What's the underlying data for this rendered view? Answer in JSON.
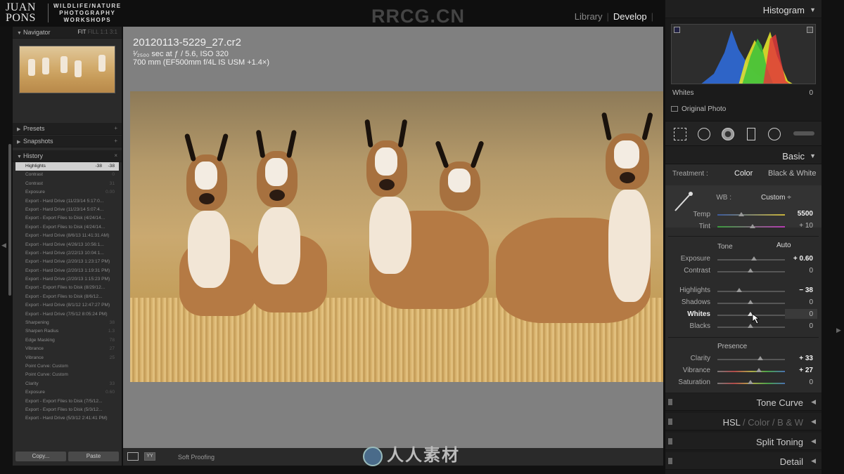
{
  "branding": {
    "logo_name": "JUAN PONS",
    "logo_line1": "WILDLIFE/NATURE",
    "logo_line2": "PHOTOGRAPHY",
    "logo_line3": "WORKSHOPS",
    "watermark": "RRCG.CN",
    "bottom_watermark": "人人素材"
  },
  "modules": {
    "library": "Library",
    "develop": "Develop",
    "sep": "|"
  },
  "left": {
    "navigator": {
      "title": "Navigator",
      "zoom_fit": "FIT",
      "zoom_fill": "FILL",
      "zoom_1": "1:1",
      "zoom_custom": "3:1"
    },
    "presets": {
      "title": "Presets",
      "icon": "+"
    },
    "snapshots": {
      "title": "Snapshots",
      "icon": "+"
    },
    "history": {
      "title": "History",
      "icon": "×",
      "items": [
        {
          "label": "Highlights",
          "v1": "-38",
          "v2": "-38",
          "selected": true
        },
        {
          "label": "Contrast",
          "v1": "",
          "v2": "0"
        },
        {
          "label": "Contrast",
          "v1": "",
          "v2": "31"
        },
        {
          "label": "Exposure",
          "v1": "",
          "v2": "0.00"
        },
        {
          "label": "Export - Hard Drive (11/23/14 5:17:0...",
          "v1": "",
          "v2": ""
        },
        {
          "label": "Export - Hard Drive (11/23/14 5:07:4...",
          "v1": "",
          "v2": ""
        },
        {
          "label": "Export - Export Files to Disk (4/24/14...",
          "v1": "",
          "v2": ""
        },
        {
          "label": "Export - Export Files to Disk (4/24/14...",
          "v1": "",
          "v2": ""
        },
        {
          "label": "Export - Hard Drive (8/6/13 11:41:31 AM)",
          "v1": "",
          "v2": ""
        },
        {
          "label": "Export - Hard Drive (4/26/13 10:56:1...",
          "v1": "",
          "v2": ""
        },
        {
          "label": "Export - Hard Drive (2/22/13 10:04:1...",
          "v1": "",
          "v2": ""
        },
        {
          "label": "Export - Hard Drive (2/20/13 1:23:17 PM)",
          "v1": "",
          "v2": ""
        },
        {
          "label": "Export - Hard Drive (2/20/13 1:19:31 PM)",
          "v1": "",
          "v2": ""
        },
        {
          "label": "Export - Hard Drive (2/20/13 1:15:23 PM)",
          "v1": "",
          "v2": ""
        },
        {
          "label": "Export - Export Files to Disk (8/29/12...",
          "v1": "",
          "v2": ""
        },
        {
          "label": "Export - Export Files to Disk (8/6/12...",
          "v1": "",
          "v2": ""
        },
        {
          "label": "Export - Hard Drive (8/1/12 12:47:27 PM)",
          "v1": "",
          "v2": ""
        },
        {
          "label": "Export - Hard Drive (7/5/12 8:05:24 PM)",
          "v1": "",
          "v2": ""
        },
        {
          "label": "Sharpening",
          "v1": "",
          "v2": "38"
        },
        {
          "label": "Sharpen Radius",
          "v1": "",
          "v2": "1.3"
        },
        {
          "label": "Edge Masking",
          "v1": "",
          "v2": "78"
        },
        {
          "label": "Vibrance",
          "v1": "",
          "v2": "27"
        },
        {
          "label": "Vibrance",
          "v1": "",
          "v2": "25"
        },
        {
          "label": "Point Curve: Custom",
          "v1": "",
          "v2": ""
        },
        {
          "label": "Point Curve: Custom",
          "v1": "",
          "v2": ""
        },
        {
          "label": "Clarity",
          "v1": "",
          "v2": "33"
        },
        {
          "label": "Exposure",
          "v1": "",
          "v2": "0.60"
        },
        {
          "label": "Export - Export Files to Disk (7/5/12...",
          "v1": "",
          "v2": ""
        },
        {
          "label": "Export - Export Files to Disk (5/3/12...",
          "v1": "",
          "v2": ""
        },
        {
          "label": "Export - Hard Drive (5/3/12 2:41:41 PM)",
          "v1": "",
          "v2": ""
        }
      ]
    },
    "copy_label": "Copy...",
    "paste_label": "Paste"
  },
  "image": {
    "filename": "20120113-5229_27.cr2",
    "exposure_line": "¹⁄₂₅₀₀ sec at ƒ / 5.6, ISO 320",
    "lens_line": "700 mm (EF500mm f/4L IS USM +1.4×)"
  },
  "toolbar": {
    "soft_proofing": "Soft Proofing",
    "yy_label": "YY"
  },
  "right": {
    "histogram": {
      "title": "Histogram",
      "info_label": "Whites",
      "info_value": "0",
      "original_photo": "Original Photo"
    },
    "basic": {
      "title": "Basic",
      "treatment_label": "Treatment :",
      "color": "Color",
      "bw": "Black & White",
      "wb_label": "WB :",
      "wb_value": "Custom ÷",
      "temp_label": "Temp",
      "temp_value": "5500",
      "tint_label": "Tint",
      "tint_value": "+ 10",
      "tone_label": "Tone",
      "auto_label": "Auto",
      "exposure_label": "Exposure",
      "exposure_value": "+ 0.60",
      "contrast_label": "Contrast",
      "contrast_value": "0",
      "highlights_label": "Highlights",
      "highlights_value": "− 38",
      "shadows_label": "Shadows",
      "shadows_value": "0",
      "whites_label": "Whites",
      "whites_value": "0",
      "blacks_label": "Blacks",
      "blacks_value": "0",
      "presence_label": "Presence",
      "clarity_label": "Clarity",
      "clarity_value": "+ 33",
      "vibrance_label": "Vibrance",
      "vibrance_value": "+ 27",
      "saturation_label": "Saturation",
      "saturation_value": "0"
    },
    "tone_curve": "Tone Curve",
    "hsl": {
      "h": "HSL",
      "sep1": " / ",
      "color": "Color",
      "sep2": " / ",
      "bw": "B & W"
    },
    "split_toning": "Split Toning",
    "detail": "Detail"
  }
}
